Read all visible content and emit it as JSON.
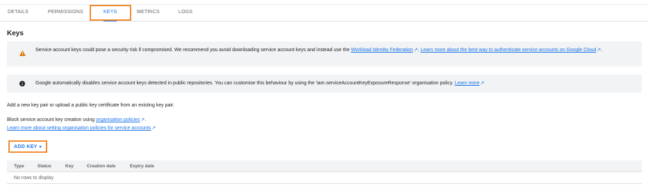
{
  "tabs": [
    {
      "label": "DETAILS",
      "active": false
    },
    {
      "label": "PERMISSIONS",
      "active": false
    },
    {
      "label": "KEYS",
      "active": true
    },
    {
      "label": "METRICS",
      "active": false
    },
    {
      "label": "LOGS",
      "active": false
    }
  ],
  "page": {
    "title": "Keys"
  },
  "warning": {
    "icon": "warning-triangle-icon",
    "line1_text": "Service account keys could pose a security risk if compromised. We recommend you avoid downloading service account keys and instead use the ",
    "link1": "Workload Identity Federation",
    "link2": "Learn more about the best way to authenticate service accounts on Google Cloud",
    "line2_suffix": "."
  },
  "info": {
    "icon": "info-filled-icon",
    "text": "Google automatically disables service account keys detected in public repositories. You can customise this behaviour by using the 'iam.serviceAccountKeyExposureResponse' organisation policy. ",
    "link": "Learn more"
  },
  "intro": "Add a new key pair or upload a public key certificate from an existing key pair.",
  "block": {
    "prefix": "Block service account key creation using ",
    "link": "organisation policies",
    "suffix": ".",
    "learn_link": "Learn more about setting organisation policies for service accounts"
  },
  "add_key": {
    "label": "ADD KEY",
    "caret": "▾"
  },
  "table": {
    "columns": [
      "Type",
      "Status",
      "Key",
      "Creation date",
      "Expiry date"
    ],
    "empty_text": "No rows to display"
  },
  "colors": {
    "accent": "#1a73e8",
    "warning": "#e37400",
    "highlight": "#f28b30"
  }
}
